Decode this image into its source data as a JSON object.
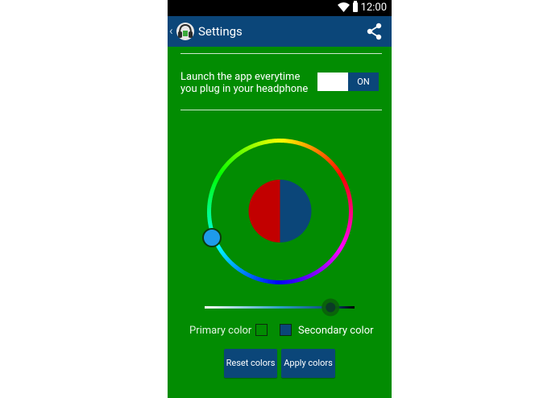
{
  "status_bar": {
    "time": "12:00"
  },
  "action_bar": {
    "back_glyph": "‹",
    "title": "Settings",
    "icons": [
      "app-headphone-icon",
      "share-icon"
    ]
  },
  "launch_setting": {
    "label": "Launch the app everytime you plug in your headphone",
    "toggle_state": "ON"
  },
  "color_picker": {
    "left_half_color": "#c20000",
    "right_half_color": "#0b4679",
    "handle_color": "#1e9bea",
    "slider_value": 0.84
  },
  "colors": {
    "background": "#028c02",
    "accent": "#0b4679",
    "primary_label": "Primary color",
    "secondary_label": "Secondary color"
  },
  "buttons": {
    "reset": "Reset colors",
    "apply": "Apply colors"
  }
}
